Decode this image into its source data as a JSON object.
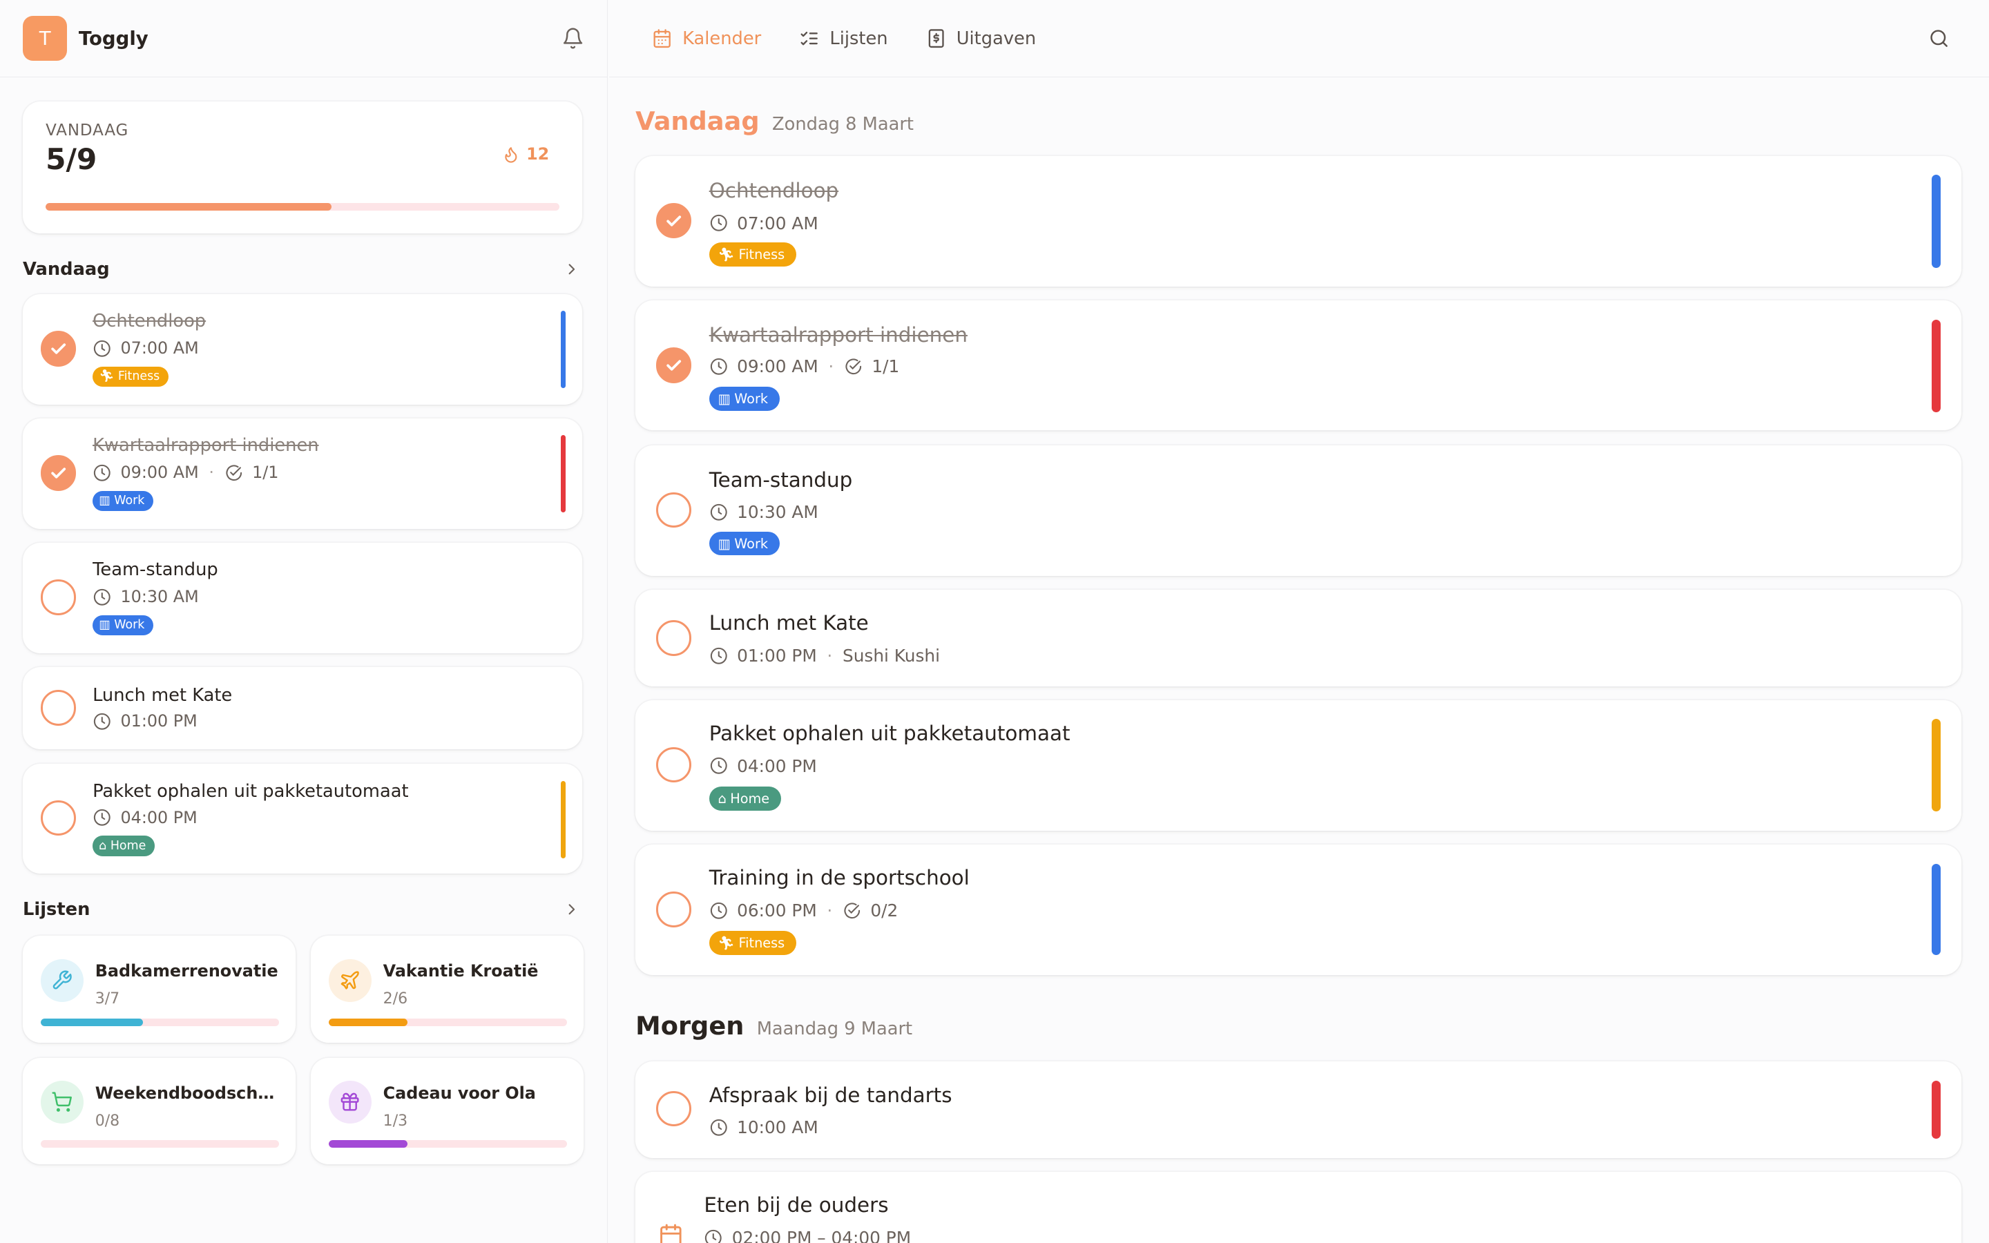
{
  "app": {
    "avatar_letter": "T",
    "name": "Toggly"
  },
  "summary": {
    "label": "VANDAAG",
    "count": "5/9",
    "progress": 0.556,
    "streak": "12"
  },
  "sidebar": {
    "today_title": "Vandaag",
    "tasks": [
      {
        "title": "Ochtendloop",
        "time": "07:00 AM",
        "done": true,
        "tag": "Fitness"
      },
      {
        "title": "Kwartaalrapport indienen",
        "time": "09:00 AM",
        "subtasks": "1/1",
        "done": true,
        "tag": "Work"
      },
      {
        "title": "Team-standup",
        "time": "10:30 AM",
        "done": false,
        "tag": "Work"
      },
      {
        "title": "Lunch met Kate",
        "time": "01:00 PM",
        "done": false
      },
      {
        "title": "Pakket ophalen uit pakketautomaat",
        "time": "04:00 PM",
        "done": false,
        "tag": "Home"
      }
    ],
    "lists_title": "Lijsten",
    "lists": [
      {
        "name": "Badkamerrenovatie",
        "count": "3/7",
        "progress": 0.43,
        "icon": "wrench-icon",
        "color": "#3fb3d4"
      },
      {
        "name": "Vakantie Kroatië",
        "count": "2/6",
        "progress": 0.33,
        "icon": "plane-icon",
        "color": "#f39c12"
      },
      {
        "name": "Weekendboodschappen",
        "count": "0/8",
        "progress": 0,
        "icon": "cart-icon",
        "color": "#3fbf6a"
      },
      {
        "name": "Cadeau voor Ola",
        "count": "1/3",
        "progress": 0.33,
        "icon": "gift-icon",
        "color": "#a349d6"
      }
    ]
  },
  "nav": {
    "calendar": "Kalender",
    "lists": "Lijsten",
    "expenses": "Uitgaven"
  },
  "main": {
    "today": {
      "title": "Vandaag",
      "date": "Zondag 8 Maart"
    },
    "today_tasks": [
      {
        "title": "Ochtendloop",
        "time": "07:00 AM",
        "done": true,
        "tag": "Fitness"
      },
      {
        "title": "Kwartaalrapport indienen",
        "time": "09:00 AM",
        "subtasks": "1/1",
        "done": true,
        "tag": "Work"
      },
      {
        "title": "Team-standup",
        "time": "10:30 AM",
        "done": false,
        "tag": "Work"
      },
      {
        "title": "Lunch met Kate",
        "time": "01:00 PM",
        "location": "Sushi Kushi",
        "done": false
      },
      {
        "title": "Pakket ophalen uit pakketautomaat",
        "time": "04:00 PM",
        "done": false,
        "tag": "Home"
      },
      {
        "title": "Training in de sportschool",
        "time": "06:00 PM",
        "subtasks": "0/2",
        "done": false,
        "tag": "Fitness"
      }
    ],
    "tomorrow": {
      "title": "Morgen",
      "date": "Maandag 9 Maart"
    },
    "tomorrow_tasks": [
      {
        "title": "Afspraak bij de tandarts",
        "time": "10:00 AM",
        "done": false
      },
      {
        "title": "Eten bij de ouders",
        "time": "02:00 PM – 04:00 PM"
      }
    ]
  },
  "colors": {
    "accent": "#f5956a",
    "blue": "#3778e8",
    "red": "#e5393d",
    "yellow": "#f0a50e"
  }
}
